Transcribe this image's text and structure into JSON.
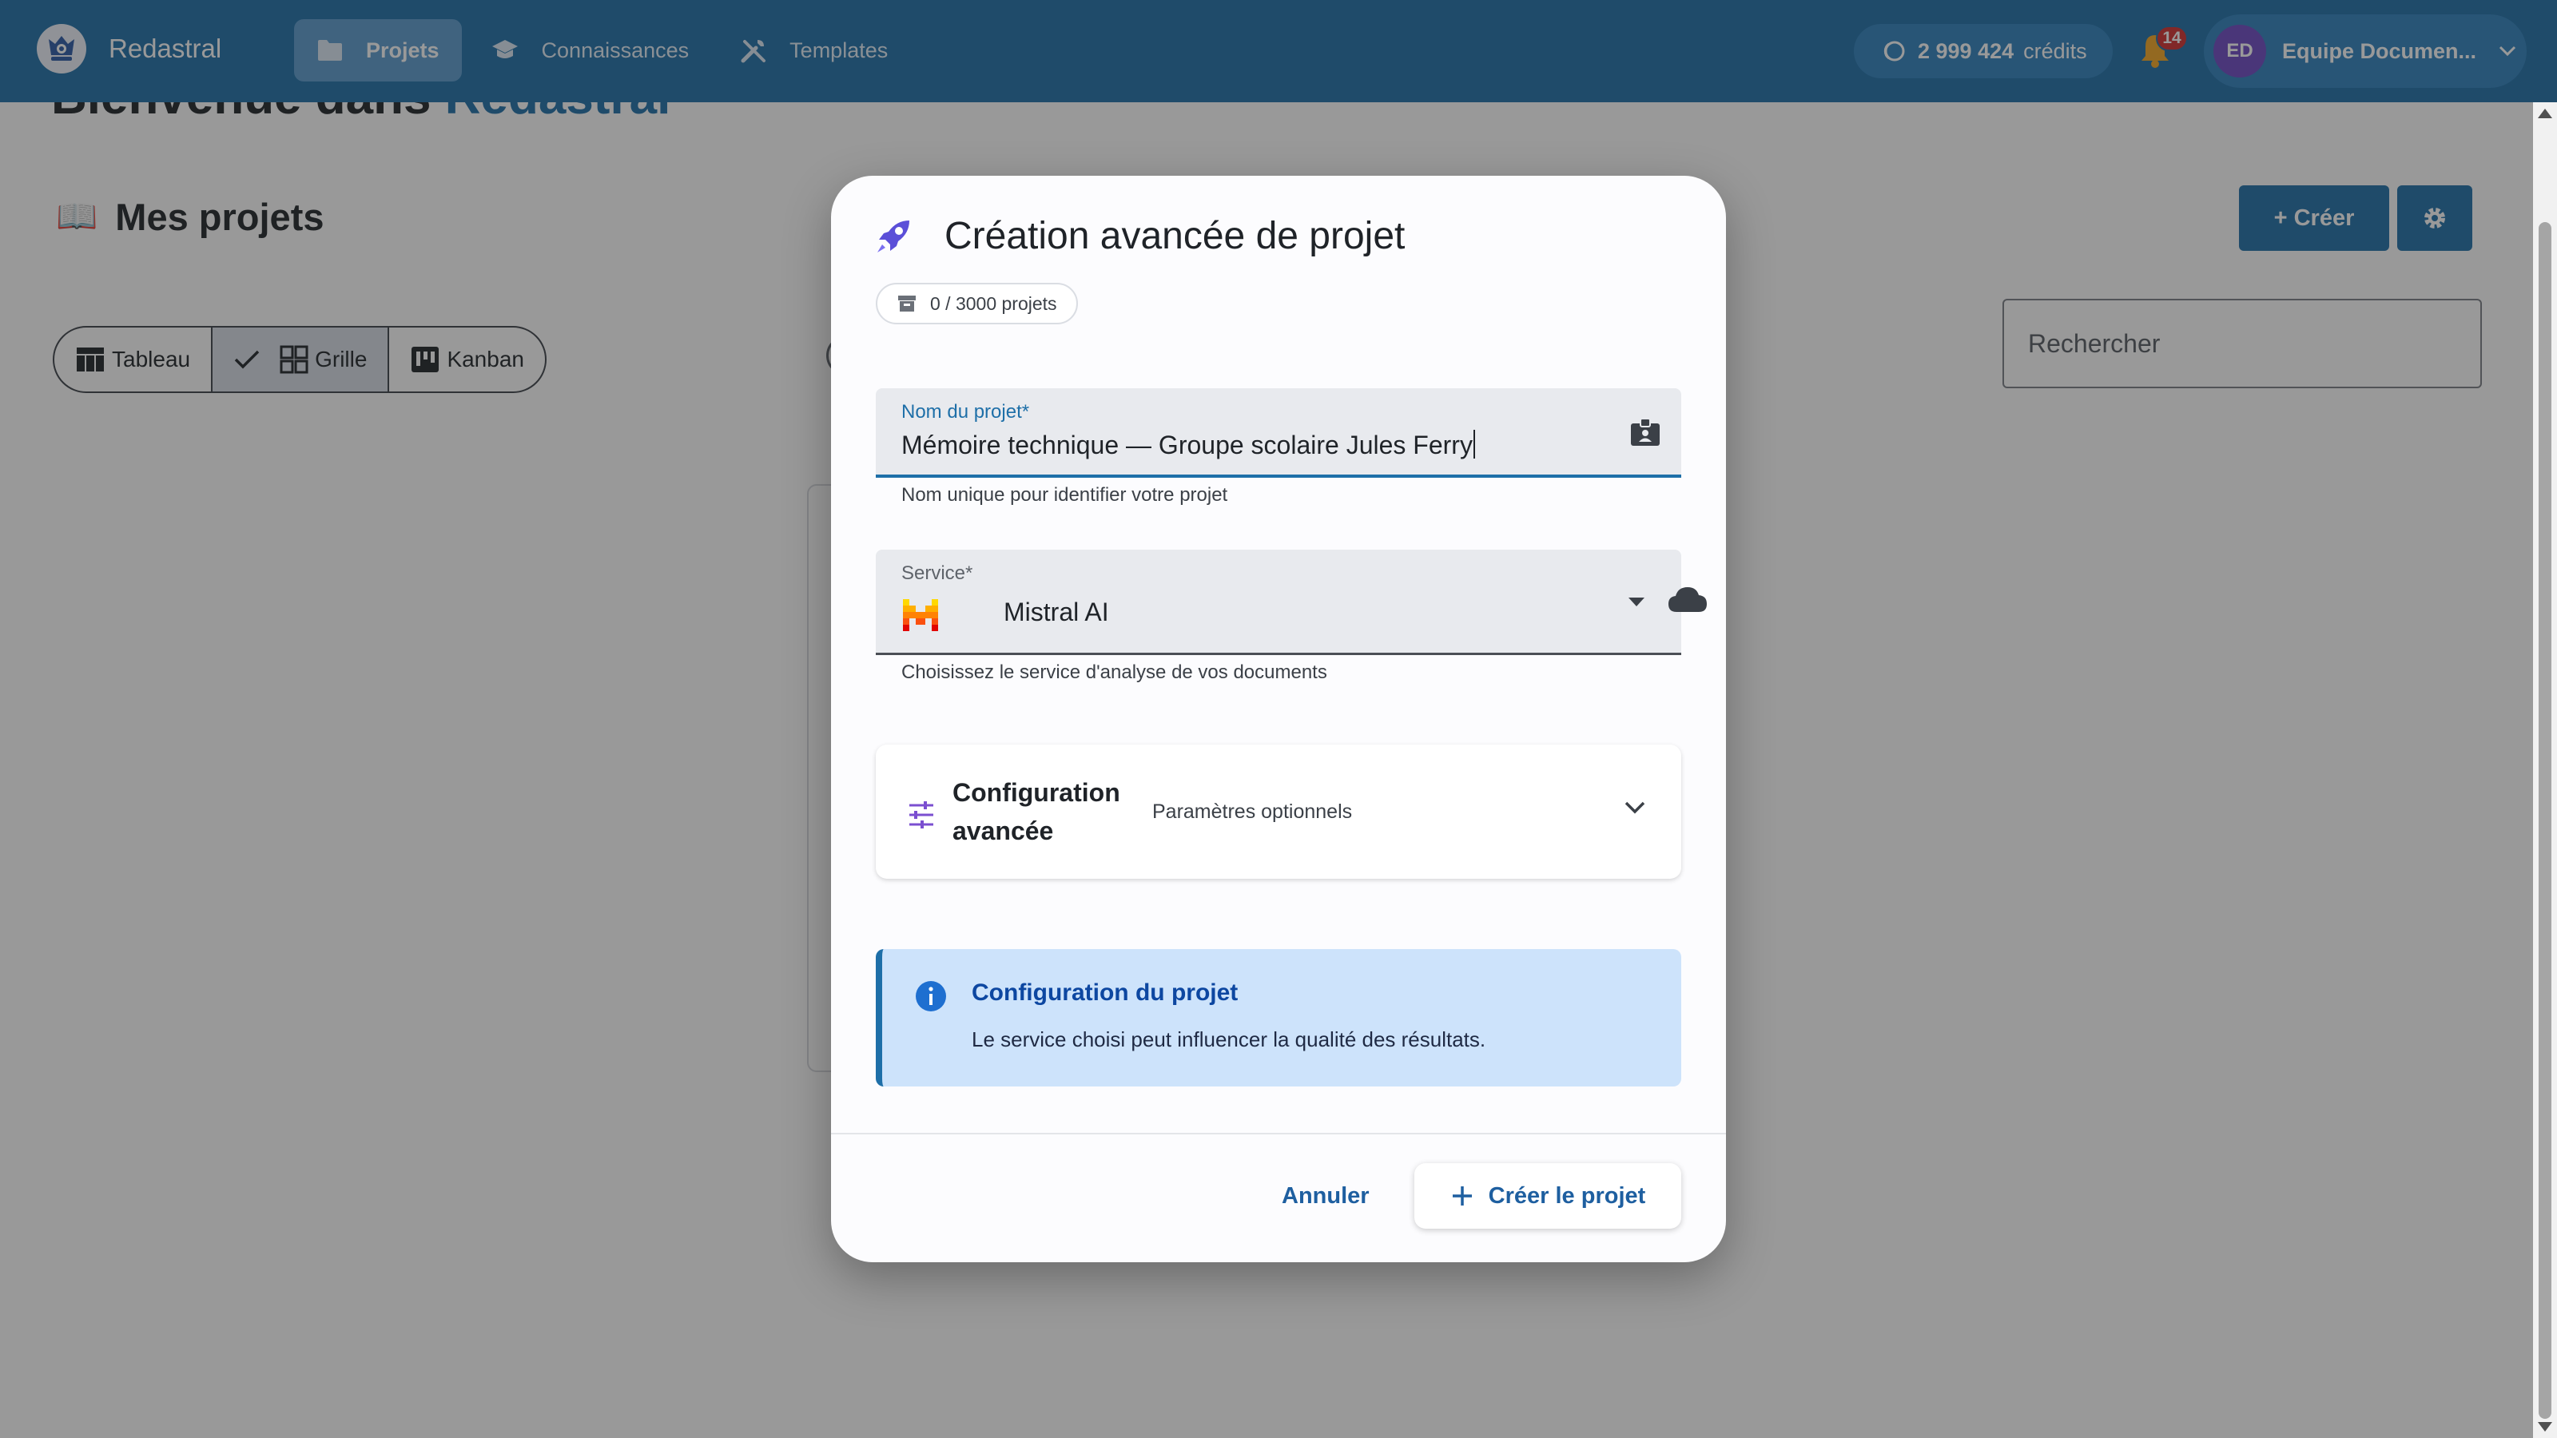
{
  "app": {
    "name": "Redastral"
  },
  "nav": [
    {
      "label": "Projets",
      "icon": "folder-icon",
      "active": true
    },
    {
      "label": "Connaissances",
      "icon": "graduation-cap-icon",
      "active": false
    },
    {
      "label": "Templates",
      "icon": "tools-icon",
      "active": false
    }
  ],
  "credits": {
    "amount": "2 999 424",
    "unit": "crédits"
  },
  "notifications": {
    "count": "14"
  },
  "user": {
    "initials": "ED",
    "name": "Equipe Documen..."
  },
  "page": {
    "welcome_prefix": "Bienvenue dans",
    "welcome_brand": "Redastral",
    "section_title": "Mes projets",
    "views": [
      {
        "label": "Tableau",
        "selected": false
      },
      {
        "label": "Grille",
        "selected": true
      },
      {
        "label": "Kanban",
        "selected": false
      }
    ],
    "create_label": "+ Créer",
    "search_placeholder": "Rechercher"
  },
  "dialog": {
    "title": "Création avancée de projet",
    "quota": "0 / 3000 projets",
    "name_field": {
      "label": "Nom du projet*",
      "value": "Mémoire technique — Groupe scolaire Jules Ferry",
      "hint": "Nom unique pour identifier votre projet"
    },
    "service_field": {
      "label": "Service*",
      "value": "Mistral AI",
      "hint": "Choisissez le service d'analyse de vos documents"
    },
    "advanced": {
      "title": "Configuration avancée",
      "subtitle": "Paramètres optionnels"
    },
    "info": {
      "title": "Configuration du projet",
      "text": "Le service choisi peut influencer la qualité des résultats."
    },
    "cancel_label": "Annuler",
    "create_label": "Créer le projet"
  },
  "colors": {
    "primary": "#1e6fa8",
    "accent_purple": "#6d48c4",
    "info_bg": "#cde3fb",
    "badge_red": "#d32f2f"
  }
}
